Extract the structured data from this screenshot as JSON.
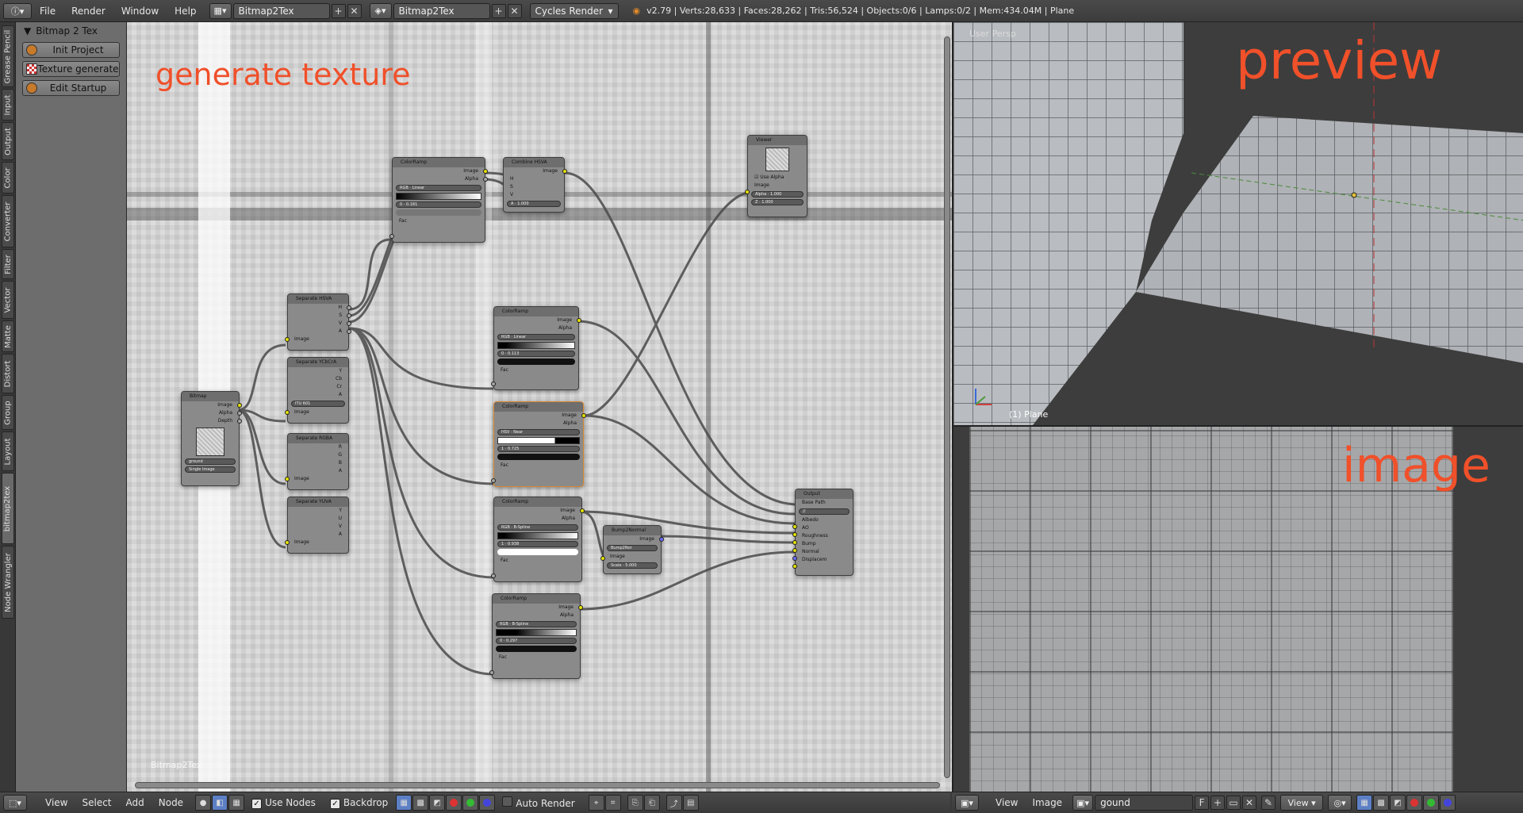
{
  "topbar": {
    "menus": [
      "File",
      "Render",
      "Window",
      "Help"
    ],
    "screen_layout": "Bitmap2Tex",
    "scene": "Bitmap2Tex",
    "render_engine": "Cycles Render",
    "stats": "v2.79 | Verts:28,633 | Faces:28,262 | Tris:56,524 | Objects:0/6 | Lamps:0/2 | Mem:434.04M | Plane"
  },
  "tabs": [
    "Grease Pencil",
    "Input",
    "Output",
    "Color",
    "Converter",
    "Filter",
    "Vector",
    "Matte",
    "Distort",
    "Group",
    "Layout",
    "bitmap2tex",
    "Node Wrangler"
  ],
  "toolshelf": {
    "panel_title": "Bitmap 2 Tex",
    "buttons": [
      "Init Project",
      "Texture generate",
      "Edit Startup"
    ]
  },
  "node_editor": {
    "title": "generate texture",
    "tree_name": "Bitmap2Tex",
    "nodes": {
      "bitmap": {
        "title": "Bitmap",
        "outputs": [
          "Image",
          "Alpha",
          "Depth"
        ],
        "image": "ground",
        "mode": "Single Image"
      },
      "sep_hsva": {
        "title": "Separate HSVA",
        "outputs": [
          "H",
          "S",
          "V",
          "A"
        ],
        "input": "Image"
      },
      "sep_ycc": {
        "title": "Separate YCbCrA",
        "outputs": [
          "Y",
          "Cb",
          "Cr",
          "A"
        ],
        "mode": "ITU 601",
        "input": "Image"
      },
      "sep_rgba": {
        "title": "Separate RGBA",
        "outputs": [
          "R",
          "G",
          "B",
          "A"
        ],
        "input": "Image"
      },
      "sep_yuva": {
        "title": "Separate YUVA",
        "outputs": [
          "Y",
          "U",
          "V",
          "A"
        ],
        "input": "Image"
      },
      "ramp1": {
        "title": "ColorRamp",
        "outputs": [
          "Image",
          "Alpha"
        ],
        "mode": "RGB",
        "interp": "Linear",
        "index": "0",
        "pos": "0.181",
        "input": "Fac"
      },
      "combine": {
        "title": "Combine HSVA",
        "output": "Image",
        "inputs": [
          "H",
          "S",
          "V"
        ],
        "alpha": "A",
        "alpha_value": "1.000"
      },
      "viewer": {
        "title": "Viewer",
        "use_alpha": "Use Alpha",
        "inputs": [
          "Image",
          "Alpha",
          "Z"
        ],
        "alpha_value": "1.000",
        "z_value": "1.000"
      },
      "ramp2": {
        "title": "ColorRamp",
        "outputs": [
          "Image",
          "Alpha"
        ],
        "mode": "RGB",
        "interp": "Linear",
        "index": "0",
        "pos": "0.113",
        "input": "Fac"
      },
      "ramp3": {
        "title": "ColorRamp",
        "outputs": [
          "Image",
          "Alpha"
        ],
        "mode": "HSV",
        "interp": "Near",
        "index": "1",
        "pos": "0.725",
        "input": "Fac"
      },
      "ramp4": {
        "title": "ColorRamp",
        "outputs": [
          "Image",
          "Alpha"
        ],
        "mode": "RGB",
        "interp": "B-Spline",
        "index": "1",
        "pos": "0.938",
        "input": "Fac"
      },
      "ramp5": {
        "title": "ColorRamp",
        "outputs": [
          "Image",
          "Alpha"
        ],
        "mode": "RGB",
        "interp": "B-Spline",
        "index": "0",
        "pos": "0.297",
        "input": "Fac"
      },
      "bump": {
        "title": "Bump2Normal",
        "output": "Image",
        "field": "Bump2Nor",
        "input": "Image",
        "scale_label": "Scale",
        "scale_value": "5.000"
      },
      "output": {
        "title": "Output",
        "base_path_label": "Base Path",
        "base_path": "//",
        "inputs": [
          "Albedo",
          "AO",
          "Roughness",
          "Bump",
          "Normal",
          "Displacem"
        ]
      }
    }
  },
  "viewport": {
    "view_label": "User Persp",
    "title": "preview",
    "object_label": "(1) Plane"
  },
  "image_editor": {
    "title": "image"
  },
  "node_footer": {
    "menus": [
      "View",
      "Select",
      "Add",
      "Node"
    ],
    "use_nodes": "Use Nodes",
    "backdrop": "Backdrop",
    "auto_render": "Auto Render"
  },
  "image_footer": {
    "menus": [
      "View",
      "Image"
    ],
    "image_name": "gound",
    "fake_user": "F",
    "view_menu": "View"
  }
}
